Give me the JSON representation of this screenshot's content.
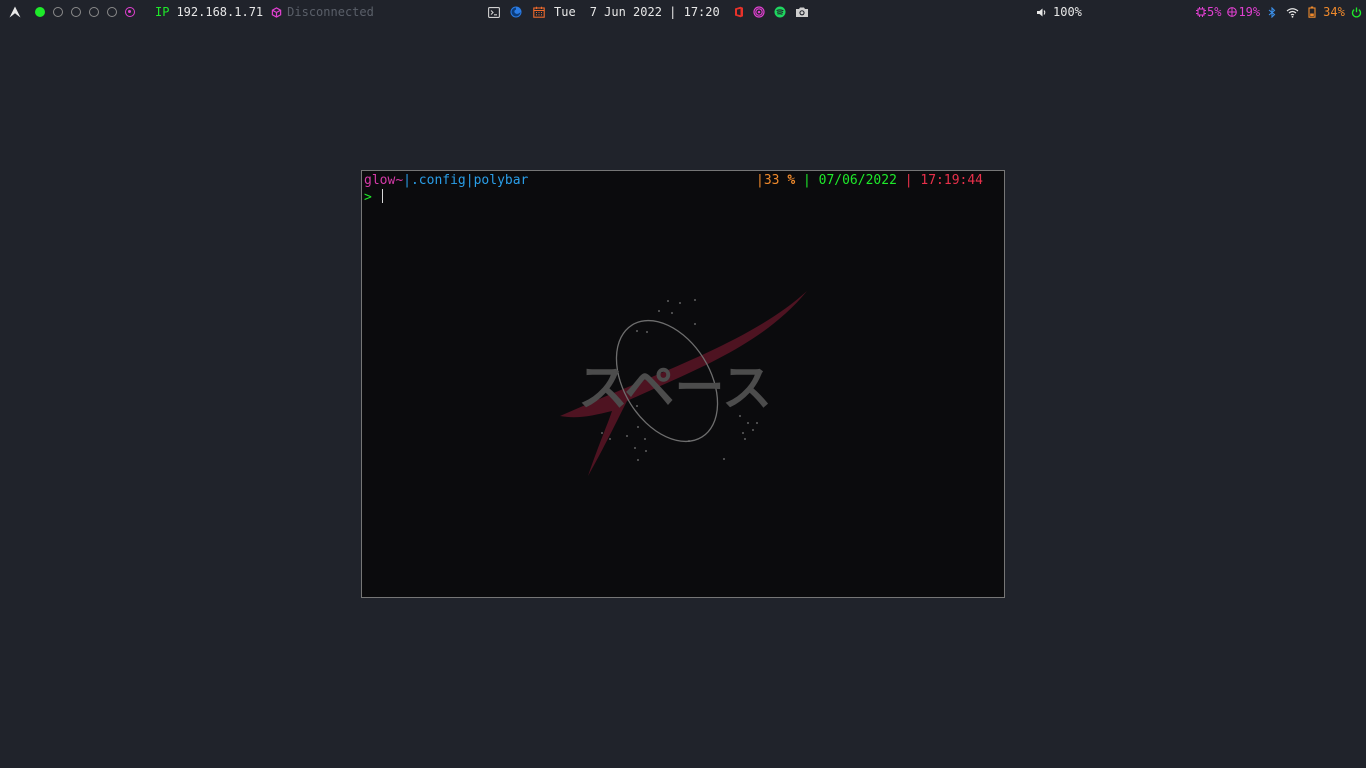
{
  "topbar": {
    "launcher_icon": "arch-logo-icon",
    "workspaces": [
      {
        "state": "active"
      },
      {
        "state": "idle"
      },
      {
        "state": "idle"
      },
      {
        "state": "idle"
      },
      {
        "state": "idle"
      },
      {
        "state": "urgent"
      }
    ],
    "ip_label": "IP",
    "ip_value": "192.168.1.71",
    "vpn_status": "Disconnected",
    "date_day": "Tue",
    "date_value": "7 Jun 2022 | 17:20",
    "volume": "100%",
    "cpu": "5%",
    "memory": "19%",
    "battery": "34%",
    "colors": {
      "green": "#1eea2a",
      "magenta": "#e040d0",
      "orange": "#f08a2c",
      "blue": "#3b8fe8",
      "dim": "#5a5f69"
    }
  },
  "terminal": {
    "prompt_user": "glow",
    "prompt_tilde": "~",
    "prompt_sep1": "|",
    "prompt_path1": ".config",
    "prompt_sep2": "|",
    "prompt_path2": "polybar",
    "right_sep1": "|",
    "right_battery": "33",
    "right_percent": "%",
    "right_sep2": "|",
    "right_date": "07/06/2022",
    "right_sep3": "|",
    "right_time": "17:19:44",
    "input_arrow": ">",
    "wallpaper_text": "スペース"
  }
}
